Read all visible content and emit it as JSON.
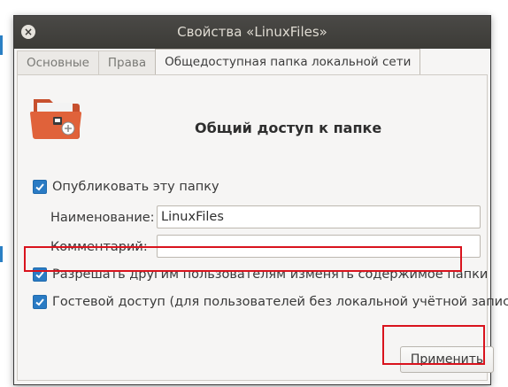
{
  "window": {
    "title": "Свойства «LinuxFiles»"
  },
  "tabs": [
    {
      "label": "Основные",
      "active": false
    },
    {
      "label": "Права",
      "active": false
    },
    {
      "label": "Общедоступная папка локальной сети",
      "active": true
    }
  ],
  "share": {
    "heading": "Общий доступ к папке",
    "publish_label": "Опубликовать эту папку",
    "publish_checked": true,
    "name_label": "Наименование:",
    "name_value": "LinuxFiles",
    "comment_label": "Комментарий:",
    "comment_value": "",
    "allow_modify_label": "Разрешать другим пользователям изменять содержимое папки",
    "allow_modify_checked": true,
    "guest_label": "Гостевой доступ (для пользователей без локальной учётной записи)",
    "guest_checked": true,
    "apply_label": "Применить"
  },
  "colors": {
    "checkbox": "#2a7bc4",
    "highlight": "#d9131d",
    "folder": "#e0623a",
    "titlebar": "#3c3b37"
  },
  "icons": {
    "close": "close-icon",
    "folder": "shared-folder-icon",
    "check": "checkmark-icon"
  }
}
